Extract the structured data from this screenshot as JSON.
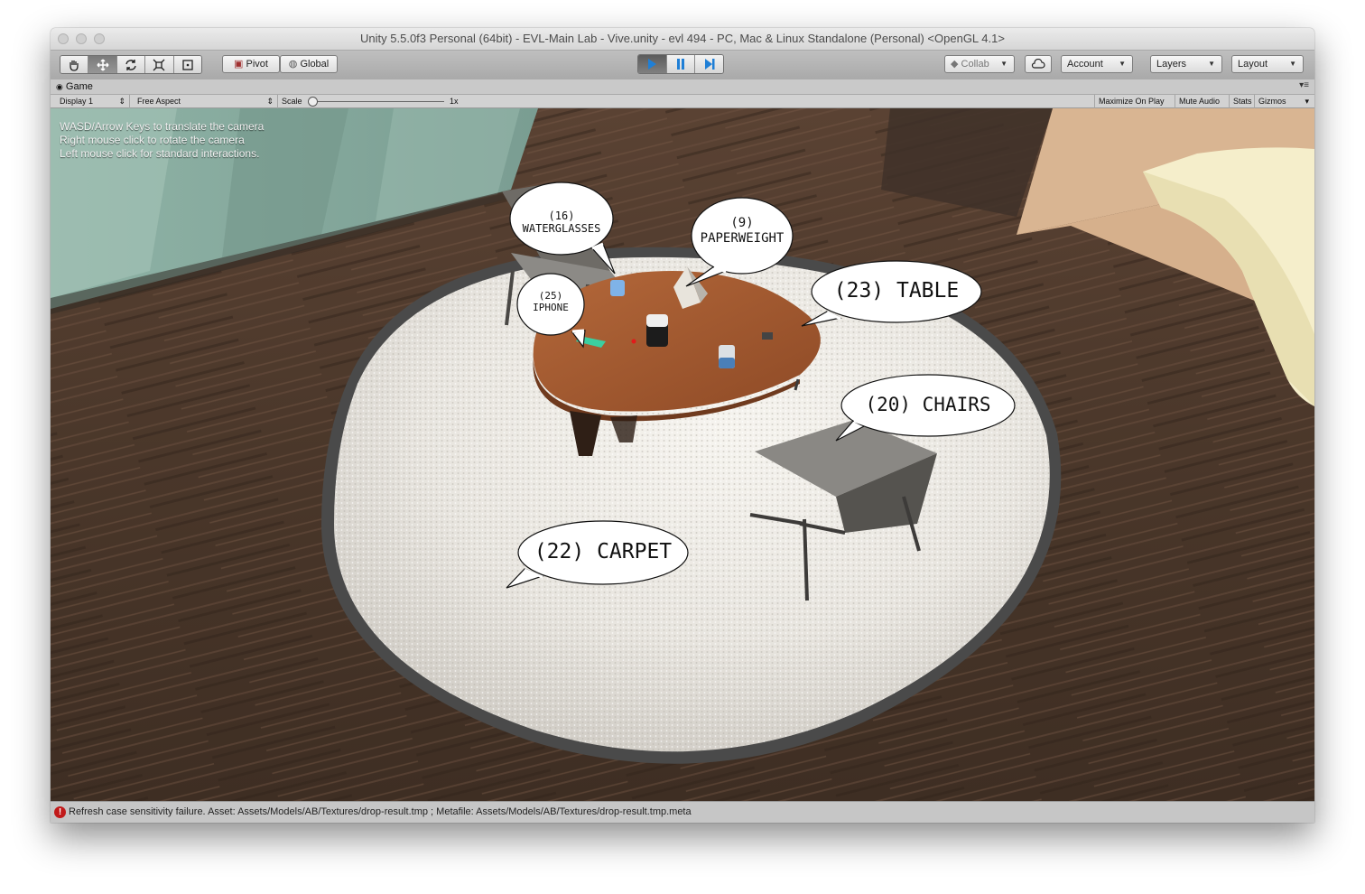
{
  "window": {
    "title": "Unity 5.5.0f3 Personal (64bit) - EVL-Main Lab - Vive.unity - evl 494 - PC, Mac & Linux Standalone (Personal) <OpenGL 4.1>"
  },
  "toolbar": {
    "tools": [
      "hand-icon",
      "move-icon",
      "rotate-icon",
      "scale-icon",
      "rect-icon"
    ],
    "pivot_label": "Pivot",
    "global_label": "Global",
    "collab_label": "Collab",
    "account_label": "Account",
    "layers_label": "Layers",
    "layout_label": "Layout",
    "play_state": "playing"
  },
  "game_view": {
    "tab_label": "Game",
    "display_label": "Display 1",
    "aspect_label": "Free Aspect",
    "scale_label": "Scale",
    "scale_value": "1x",
    "maximize_label": "Maximize On Play",
    "mute_label": "Mute Audio",
    "stats_label": "Stats",
    "gizmos_label": "Gizmos"
  },
  "instructions": [
    "WASD/Arrow Keys to translate the camera",
    "Right mouse click to rotate the camera",
    "Left mouse click for standard interactions."
  ],
  "labels": {
    "waterglasses": {
      "count": "(16)",
      "name": "WATERGLASSES"
    },
    "paperweight": {
      "count": "(9)",
      "name": "PAPERWEIGHT"
    },
    "iphone": {
      "count": "(25)",
      "name": "IPHONE"
    },
    "table": "(23) TABLE",
    "chairs": "(20) CHAIRS",
    "carpet": "(22) CARPET"
  },
  "status": {
    "message": "Refresh case sensitivity failure. Asset: Assets/Models/AB/Textures/drop-result.tmp ; Metafile: Assets/Models/AB/Textures/drop-result.tmp.meta",
    "icon": "error-icon"
  },
  "colors": {
    "floor": "#4e3a2d",
    "carpet": "#ebe8e2",
    "table": "#a55a2f",
    "error": "#c11a1a",
    "play_active": "#1f7fd6"
  }
}
